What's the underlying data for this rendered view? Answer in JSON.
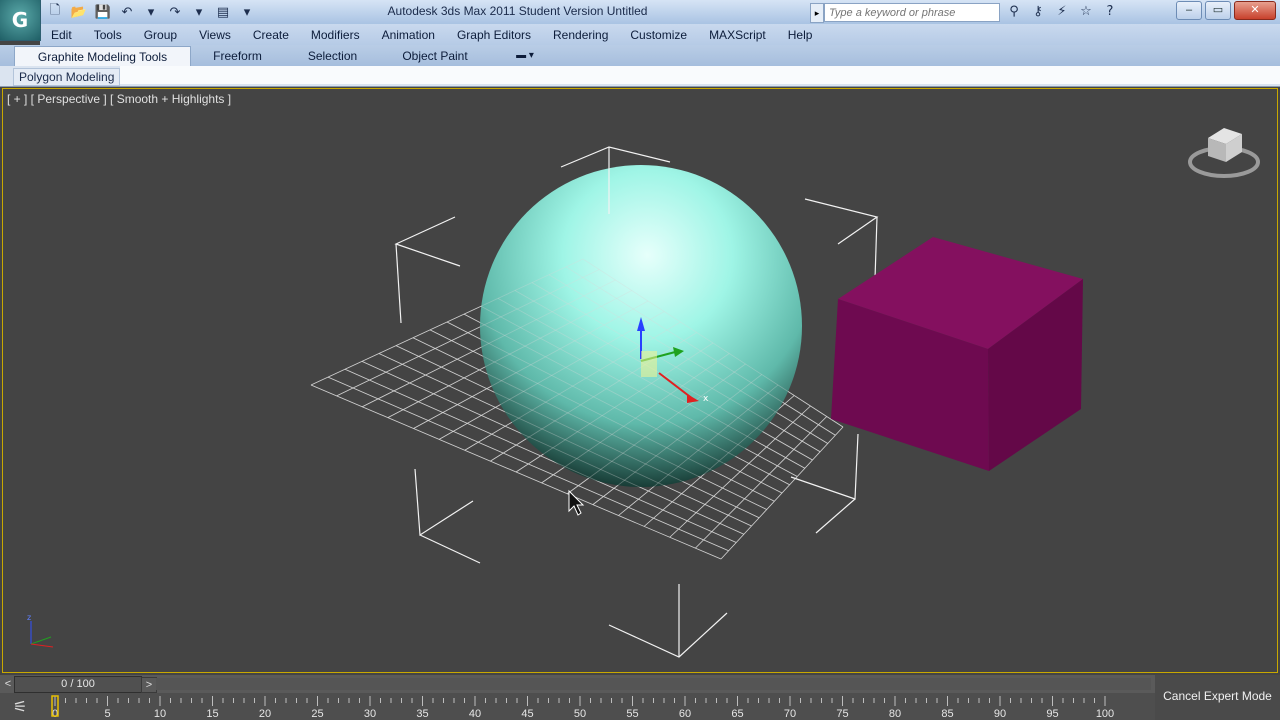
{
  "app": {
    "title": "Autodesk 3ds Max  2011    Student Version    Untitled",
    "logo_letter": "G"
  },
  "quick_access": [
    {
      "name": "new-file-icon",
      "glyph": "🗋"
    },
    {
      "name": "open-folder-icon",
      "glyph": "📂"
    },
    {
      "name": "save-icon",
      "glyph": "💾"
    },
    {
      "name": "undo-icon",
      "glyph": "↶"
    },
    {
      "name": "undo-dropdown-icon",
      "glyph": "▾"
    },
    {
      "name": "redo-icon",
      "glyph": "↷"
    },
    {
      "name": "redo-dropdown-icon",
      "glyph": "▾"
    },
    {
      "name": "project-folder-icon",
      "glyph": "▤"
    },
    {
      "name": "customize-dropdown-icon",
      "glyph": "▾"
    }
  ],
  "search": {
    "placeholder": "Type a keyword or phrase"
  },
  "search_tools": [
    {
      "name": "binoculars-icon",
      "glyph": "⚲"
    },
    {
      "name": "key-icon",
      "glyph": "⚷"
    },
    {
      "name": "exchange-icon",
      "glyph": "⚡"
    },
    {
      "name": "favorites-star-icon",
      "glyph": "☆"
    },
    {
      "name": "help-icon",
      "glyph": "?"
    }
  ],
  "window_controls": {
    "minimize": "–",
    "restore": "▭",
    "close": "✕"
  },
  "menu": [
    "Edit",
    "Tools",
    "Group",
    "Views",
    "Create",
    "Modifiers",
    "Animation",
    "Graph Editors",
    "Rendering",
    "Customize",
    "MAXScript",
    "Help"
  ],
  "ribbon": {
    "tabs": [
      "Graphite Modeling Tools",
      "Freeform",
      "Selection",
      "Object Paint"
    ],
    "active_tab": "Graphite Modeling Tools",
    "panel_label": "Polygon Modeling"
  },
  "viewport": {
    "label": "[ + ] [ Perspective ] [ Smooth + Highlights ]",
    "sphere_color": "#8ef2e0",
    "box_color": "#7a0a5a",
    "grid_color": "#d8d8d8",
    "axis_labels": {
      "x": "x",
      "y": "y",
      "z": "z"
    }
  },
  "timeline": {
    "position": "0 / 100",
    "current_frame": 0,
    "total_frames": 100,
    "prev_label": "<",
    "next_label": ">",
    "ticks": [
      0,
      5,
      10,
      15,
      20,
      25,
      30,
      35,
      40,
      45,
      50,
      55,
      60,
      65,
      70,
      75,
      80,
      85,
      90,
      95,
      100
    ]
  },
  "status": {
    "cancel_expert": "Cancel Expert Mode"
  },
  "colors": {
    "viewport_bg": "#444444",
    "title_gradient_top": "#d6e4f5",
    "active_border": "#c8a800",
    "timeline_marker": "#e8c000"
  }
}
